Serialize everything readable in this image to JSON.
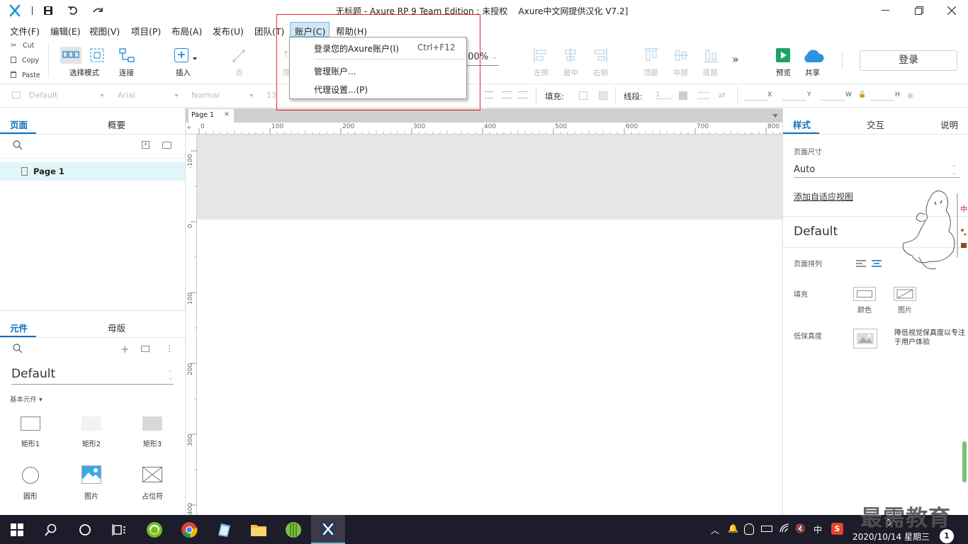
{
  "window": {
    "title": "无标题 - Axure RP 9 Team Edition : 未授权    Axure中文网提供汉化 V7.2]"
  },
  "menu": {
    "items": [
      "文件(F)",
      "编辑(E)",
      "视图(V)",
      "项目(P)",
      "布局(A)",
      "发布(U)",
      "团队(T)",
      "账户(C)",
      "帮助(H)"
    ],
    "active": "账户(C)"
  },
  "account_dropdown": {
    "login_label": "登录您的Axure账户(I)",
    "login_shortcut": "Ctrl+F12",
    "manage_label": "管理账户...",
    "proxy_label": "代理设置...(P)"
  },
  "clipboard": {
    "cut": "Cut",
    "copy": "Copy",
    "paste": "Paste"
  },
  "toolbar": {
    "select_mode": "选择模式",
    "connect": "连接",
    "insert": "插入",
    "point": "点",
    "top_partial": "顶",
    "zoom": "100%",
    "left": "左侧",
    "center": "居中",
    "right": "右侧",
    "top": "顶部",
    "middle": "中部",
    "bottom": "底部",
    "preview": "预览",
    "share": "共享",
    "login": "登录"
  },
  "stylebar": {
    "style": "Default",
    "font": "Arial",
    "weight": "Normal",
    "size": "13",
    "fill_label": "填充:",
    "line_label": "线段:",
    "line_value": "1",
    "x_label": "X",
    "y_label": "Y",
    "w_label": "W",
    "h_label": "H"
  },
  "left_panel": {
    "tabs": [
      "页面",
      "概要"
    ],
    "page_item": "Page 1",
    "widget_tabs": [
      "元件",
      "母版"
    ],
    "library": "Default",
    "category": "基本元件 ▾",
    "widgets": [
      "矩形1",
      "矩形2",
      "矩形3",
      "圆形",
      "图片",
      "占位符"
    ]
  },
  "canvas": {
    "tab_label": "Page 1",
    "hruler": [
      "0",
      "100",
      "200",
      "300",
      "400",
      "500",
      "600",
      "700",
      "800"
    ],
    "vruler": [
      "-100",
      "0",
      "100",
      "200",
      "300",
      "400"
    ]
  },
  "right_panel": {
    "tabs": [
      "样式",
      "交互",
      "说明"
    ],
    "page_size_label": "页面尺寸",
    "page_size_value": "Auto",
    "adaptive_link": "添加自适应视图",
    "style_name": "Default",
    "alignment_label": "页面排列",
    "fill_label": "填充",
    "fill_color": "颜色",
    "fill_image": "图片",
    "low_fidelity_label": "低保真度",
    "low_fidelity_desc": "降低视觉保真度以专注于用户体验"
  },
  "taskbar": {
    "time": "0",
    "date": "2020/10/14 星期三",
    "ime": "中",
    "notification_count": "1",
    "watermark": "最需教育"
  },
  "colors": {
    "accent": "#0a6fbf",
    "highlight_box": "#e8262b",
    "preview_green": "#1ea362",
    "share_blue": "#2a94e0",
    "taskbar": "#1c1c2a"
  }
}
